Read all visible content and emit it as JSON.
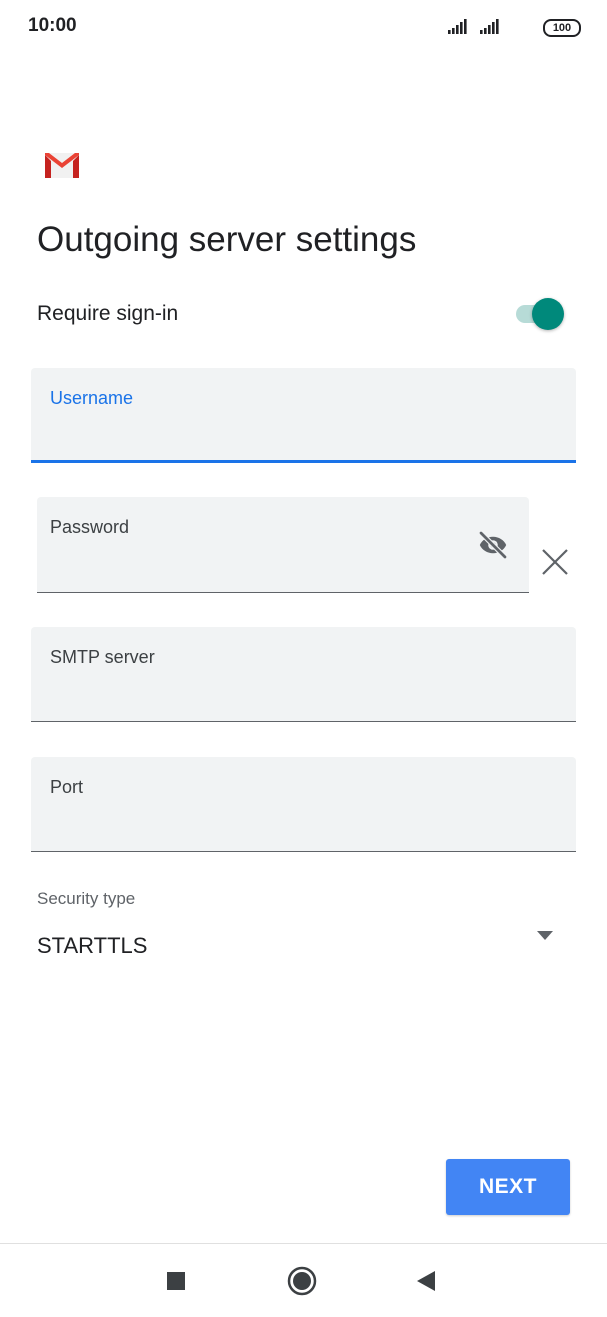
{
  "status_bar": {
    "time": "10:00",
    "battery": "100",
    "signal_icons": [
      "signal-icon",
      "signal-icon"
    ]
  },
  "app": {
    "logo_icon": "gmail-logo-icon",
    "brand_colors": [
      "#ea4335",
      "#c5221f",
      "#f1f1f1"
    ]
  },
  "page": {
    "title": "Outgoing server settings"
  },
  "require_signin": {
    "label": "Require sign-in",
    "enabled": true,
    "accent_color": "#00897b"
  },
  "fields": {
    "username": {
      "label": "Username",
      "value": "",
      "focused": true
    },
    "password": {
      "label": "Password",
      "value": "",
      "visibility_icon": "eye-off-icon",
      "clear_icon": "close-icon"
    },
    "smtp_server": {
      "label": "SMTP server",
      "value": ""
    },
    "port": {
      "label": "Port",
      "value": ""
    }
  },
  "security": {
    "label": "Security type",
    "value": "STARTTLS",
    "icon": "chevron-down-icon"
  },
  "actions": {
    "next_label": "NEXT",
    "next_color": "#4285f4"
  },
  "nav": {
    "icons": [
      "recents-icon",
      "home-icon",
      "back-icon"
    ]
  }
}
